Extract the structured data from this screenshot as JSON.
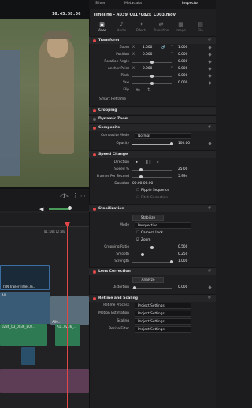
{
  "viewer": {
    "timecode": "16:45:58:06",
    "transport_icons": [
      "loop-icon",
      "in-out-icon",
      "more-icon"
    ],
    "ruler_tc": "01:00:12:00"
  },
  "timeline": {
    "clips": {
      "v2_label": "TSN Trailer Titles.m...",
      "v1a_label": "A0...",
      "v1b_label": "A09...",
      "a1_label": "0236_03_0036_B09...",
      "a2_label": "A1...0236_..."
    }
  },
  "top_tabs": {
    "silver": "Silver",
    "metadata": "Metadata",
    "inspector": "Inspector"
  },
  "clip_title": "Timeline - A039_C017082E_C003.mov",
  "inspector_tabs": [
    {
      "label": "Video",
      "icon": "video-icon"
    },
    {
      "label": "Audio",
      "icon": "audio-icon"
    },
    {
      "label": "Effects",
      "icon": "effects-icon"
    },
    {
      "label": "Transition",
      "icon": "transition-icon"
    },
    {
      "label": "Image",
      "icon": "image-icon"
    },
    {
      "label": "File",
      "icon": "file-icon"
    }
  ],
  "transform": {
    "title": "Transform",
    "zoom_label": "Zoom",
    "zoom_x": "1.000",
    "zoom_y": "1.000",
    "position_label": "Position",
    "pos_x": "0.000",
    "pos_y": "0.000",
    "rotation_label": "Rotation Angle",
    "rotation": "0.000",
    "anchor_label": "Anchor Point",
    "anchor_x": "0.000",
    "anchor_y": "0.000",
    "pitch_label": "Pitch",
    "pitch": "0.000",
    "yaw_label": "Yaw",
    "yaw": "0.000",
    "flip_label": "Flip"
  },
  "smart_reframe": "Smart Reframe",
  "cropping": "Cropping",
  "dynamic_zoom": "Dynamic Zoom",
  "composite": {
    "title": "Composite",
    "mode_label": "Composite Mode",
    "mode": "Normal",
    "opacity_label": "Opacity",
    "opacity": "100.00"
  },
  "speed": {
    "title": "Speed Change",
    "direction_label": "Direction",
    "speed_label": "Speed %",
    "speed": "25.00",
    "fps_label": "Frames Per Second",
    "fps": "5.994",
    "duration_label": "Duration",
    "duration": "00:00:06:00",
    "ripple": "Ripple Sequence",
    "pitch_corr": "Pitch Correction"
  },
  "stabilization": {
    "title": "Stabilization",
    "stabilize_btn": "Stabilize",
    "mode_label": "Mode",
    "mode": "Perspective",
    "camera_lock": "Camera Lock",
    "zoom": "Zoom",
    "ratio_label": "Cropping Ratio",
    "ratio": "0.500",
    "smooth_label": "Smooth",
    "smooth": "0.250",
    "strength_label": "Strength",
    "strength": "1.000"
  },
  "lens": {
    "title": "Lens Correction",
    "analyze_btn": "Analyze",
    "distortion_label": "Distortion",
    "distortion": "0.000"
  },
  "retime": {
    "title": "Retime and Scaling",
    "process_label": "Retime Process",
    "process": "Project Settings",
    "motion_label": "Motion Estimation",
    "motion": "Project Settings",
    "scaling_label": "Scaling",
    "scaling": "Project Settings",
    "resize_label": "Resize Filter",
    "resize": "Project Settings"
  },
  "colors": {
    "accent": "#e04848",
    "panel": "#1f1f21",
    "clip_blue": "#3a5b76",
    "clip_green": "#2e7a52"
  }
}
